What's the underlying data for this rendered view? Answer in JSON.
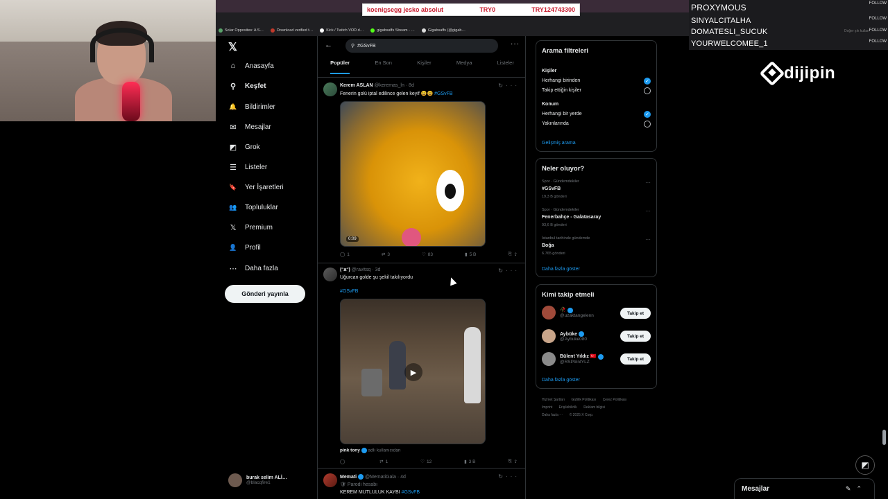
{
  "stream": {
    "donation_text": "koenigsegg jesko absolut",
    "donation_mid": "TRY0",
    "donation_right": "TRY124743300",
    "brand_logo": "dijipin",
    "follow_label": "FOLLOW",
    "followers": [
      {
        "name": "PROXYMOUS"
      },
      {
        "name": "SINYALCITALHA"
      },
      {
        "name": "DOMATESLI_SUCUK"
      },
      {
        "name": "YOURWELCOMEE_1"
      }
    ],
    "browser_controls": [
      "Doğer şık kullan"
    ]
  },
  "bookmarks": [
    "Solar Opposites: A S…",
    "Download verified t…",
    "Kick / Twitch VOD d…",
    "gigabsaffs Stream - …",
    "Gigabsaffs (@gigab…"
  ],
  "nav": {
    "logo": "𝕏",
    "items": [
      {
        "label": "Anasayfa",
        "icon": "home-icon",
        "glyph": "⌂"
      },
      {
        "label": "Keşfet",
        "icon": "search-icon",
        "glyph": "⚲",
        "active": true
      },
      {
        "label": "Bildirimler",
        "icon": "bell-icon",
        "glyph": "🔔"
      },
      {
        "label": "Mesajlar",
        "icon": "mail-icon",
        "glyph": "✉"
      },
      {
        "label": "Grok",
        "icon": "grok-icon",
        "glyph": "◩"
      },
      {
        "label": "Listeler",
        "icon": "list-icon",
        "glyph": "☰"
      },
      {
        "label": "Yer İşaretleri",
        "icon": "bookmark-icon",
        "glyph": "🔖"
      },
      {
        "label": "Topluluklar",
        "icon": "communities-icon",
        "glyph": "👥"
      },
      {
        "label": "Premium",
        "icon": "x-premium-icon",
        "glyph": "𝕏"
      },
      {
        "label": "Profil",
        "icon": "profile-icon",
        "glyph": "👤"
      },
      {
        "label": "Daha fazla",
        "icon": "more-icon",
        "glyph": "⋯"
      }
    ],
    "post_button": "Gönderi yayınla",
    "account_name": "burak selim ALİ…",
    "account_handle": "@blacqfire1"
  },
  "search": {
    "query": "#GSvFB",
    "tabs": [
      "Popüler",
      "En Son",
      "Kişiler",
      "Medya",
      "Listeler"
    ]
  },
  "tweets": [
    {
      "name": "Kerem ASLAN",
      "handle": "@keremas_ln · 8d",
      "text": "Fenerin golü iptal edilince gelen keyif 😄😃",
      "tag": "#GSvFB",
      "video_time": "0:09",
      "replies": "1",
      "retweets": "3",
      "likes": "83",
      "views": "5 B"
    },
    {
      "name": "(ᵔᴥᵔ)",
      "handle": "@ravitsq · 3d",
      "text": "Uğurcan golde şu şekil takılıyordu",
      "tag": "#GSvFB",
      "attribution": "pink tony",
      "attribution_sub": "adlı kullanıcıdan",
      "replies": "",
      "retweets": "1",
      "likes": "12",
      "views": "3 B"
    },
    {
      "name": "Memati",
      "handle": "@MematiGala · 4d",
      "parody": "Parodi hesabı",
      "text": "KEREM MUTLULUK KAYBI",
      "tag": "#GSvFB"
    }
  ],
  "filters": {
    "title": "Arama filtreleri",
    "people_label": "Kişiler",
    "people_opt1": "Herhangi birinden",
    "people_opt2": "Takip ettiğin kişiler",
    "location_label": "Konum",
    "location_opt1": "Herhangi bir yerde",
    "location_opt2": "Yakınlarında",
    "advanced": "Gelişmiş arama"
  },
  "trends": {
    "title": "Neler oluyor?",
    "items": [
      {
        "meta": "Spor · Gündemdekiler",
        "name": "#GSvFB",
        "count": "19,3 B gönderi"
      },
      {
        "meta": "Spor · Gündemdekiler",
        "name": "Fenerbahçe - Galatasaray",
        "count": "93,6 B gönderi"
      },
      {
        "meta": "İstanbul tarihinde gündemde",
        "name": "Boğa",
        "count": "6.765 gönderi"
      }
    ],
    "show_more": "Daha fazla göster"
  },
  "who_to_follow": {
    "title": "Kimi takip etmeli",
    "follow_label": "Takip et",
    "users": [
      {
        "name": "🥀",
        "handle": "@uzaktangelenn"
      },
      {
        "name": "Aybüke",
        "handle": "@Aybuke080"
      },
      {
        "name": "Bülent Yıldız 🇹🇷",
        "handle": "@RSPbIntYLZ"
      }
    ],
    "show_more": "Daha fazla göster"
  },
  "footer": {
    "links": [
      "Hizmet Şartları",
      "Gizlilik Politikası",
      "Çerez Politikası",
      "Imprint",
      "Erişilebilirlik",
      "Reklam bilgisi",
      "Daha fazla ···",
      "© 2025 X Corp."
    ]
  },
  "messages_drawer": {
    "title": "Mesajlar"
  }
}
